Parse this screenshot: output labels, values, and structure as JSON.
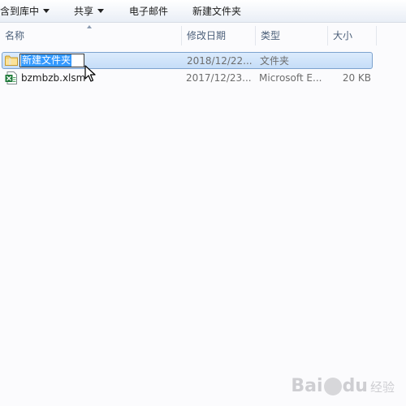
{
  "toolbar": {
    "include_library": "含到库中",
    "share": "共享",
    "email": "电子邮件",
    "new_folder": "新建文件夹"
  },
  "columns": {
    "name": "名称",
    "date_modified": "修改日期",
    "type": "类型",
    "size": "大小"
  },
  "files": [
    {
      "name": "新建文件夹",
      "date": "2018/12/22...",
      "type": "文件夹",
      "size": "",
      "icon": "folder-icon",
      "selected": true,
      "editing": true
    },
    {
      "name": "bzmbzb.xlsm",
      "date": "2017/12/23...",
      "type": "Microsoft E...",
      "size": "20 KB",
      "icon": "excel-file-icon",
      "selected": false,
      "editing": false
    }
  ],
  "watermark": {
    "brand": "Bai",
    "brand_tail": "du",
    "sub": "经验"
  },
  "colors": {
    "selection_fill": "#c5ddf8",
    "selection_border": "#7da2ce",
    "text_highlight": "#3399ff",
    "header_text": "#4c607a"
  }
}
